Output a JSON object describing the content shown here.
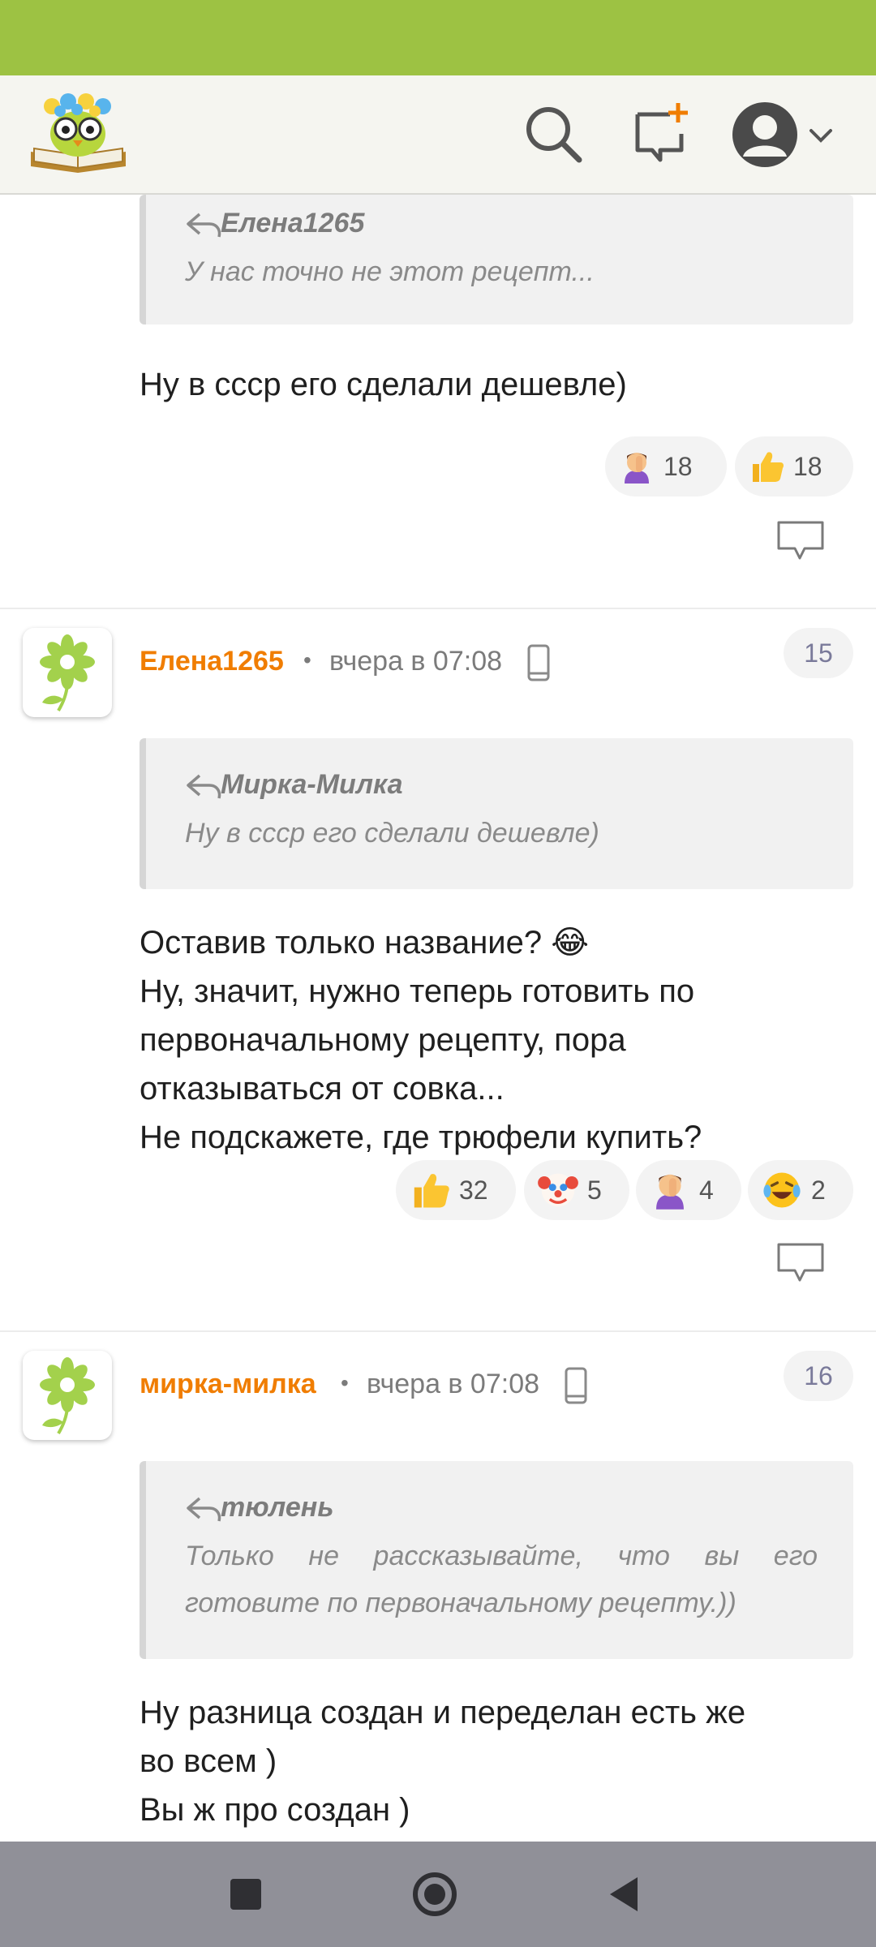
{
  "colors": {
    "status_bar": "#9dc243",
    "author": "#f07d00",
    "quote_text": "#8a8a8a",
    "nav_bar": "#909098"
  },
  "app_bar": {
    "logo": "book-owl-flowers-logo",
    "icons": [
      "search-icon",
      "new-message-icon",
      "profile-icon",
      "chevron-down-icon"
    ]
  },
  "comments": [
    {
      "quote": {
        "author": "Елена1265",
        "text": "У нас точно не этот рецепт..."
      },
      "text_lines": [
        "Ну в ссср его сделали дешевле)"
      ],
      "reactions": [
        {
          "icon": "facepalm-emoji",
          "count": "18"
        },
        {
          "icon": "thumbs-up-emoji",
          "count": "18"
        }
      ]
    },
    {
      "author": "Елена1265",
      "time": "вчера в 07:08",
      "number": "15",
      "quote": {
        "author": "Мирка-Милка",
        "text": "Ну в ссср его сделали дешевле)"
      },
      "text_lines": [
        "Оставив только название? 😂",
        "Ну, значит, нужно теперь готовить по",
        "первоначальному рецепту, пора",
        "отказываться от совка...",
        "Не подскажете, где трюфели купить?"
      ],
      "reactions": [
        {
          "icon": "thumbs-up-emoji",
          "count": "32"
        },
        {
          "icon": "clown-emoji",
          "count": "5"
        },
        {
          "icon": "facepalm-emoji",
          "count": "4"
        },
        {
          "icon": "laughing-tears-emoji",
          "count": "2"
        }
      ]
    },
    {
      "author": "мирка-милка",
      "time": "вчера в 07:08",
      "number": "16",
      "quote": {
        "author": "тюлень",
        "text": "Только не рассказывайте, что вы его готовите по первоначальному рецепту.))"
      },
      "text_lines": [
        "Ну разница создан и переделан есть же",
        "во всем )",
        "Вы ж про создан )"
      ]
    }
  ],
  "nav": [
    "recent-apps-icon",
    "home-icon",
    "back-icon"
  ]
}
